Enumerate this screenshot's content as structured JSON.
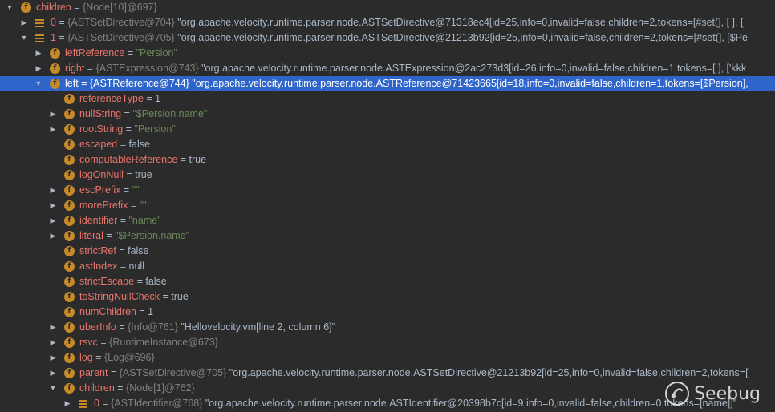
{
  "watermark": {
    "text": "Seebug",
    "icon": "seebug-logo-icon"
  },
  "rows": [
    {
      "depth": 0,
      "arrow": "down",
      "icon": "field",
      "name": "children",
      "type": "{Node[10]@697}",
      "desc": ""
    },
    {
      "depth": 1,
      "arrow": "right",
      "icon": "array",
      "name": "0",
      "type": "{ASTSetDirective@704}",
      "desc": "\"org.apache.velocity.runtime.parser.node.ASTSetDirective@71318ec4[id=25,info=0,invalid=false,children=2,tokens=[#set(], [ ], ["
    },
    {
      "depth": 1,
      "arrow": "down",
      "icon": "array",
      "name": "1",
      "type": "{ASTSetDirective@705}",
      "desc": "\"org.apache.velocity.runtime.parser.node.ASTSetDirective@21213b92[id=25,info=0,invalid=false,children=2,tokens=[#set(], [$Pe"
    },
    {
      "depth": 2,
      "arrow": "right",
      "icon": "field",
      "name": "leftReference",
      "type": "",
      "desc": "",
      "str": "\"Persion\""
    },
    {
      "depth": 2,
      "arrow": "right",
      "icon": "field",
      "name": "right",
      "type": "{ASTExpression@743}",
      "desc": "\"org.apache.velocity.runtime.parser.node.ASTExpression@2ac273d3[id=26,info=0,invalid=false,children=1,tokens=[ ], ['kkk"
    },
    {
      "depth": 2,
      "arrow": "down",
      "icon": "field",
      "name": "left",
      "type": "{ASTReference@744}",
      "desc": "\"org.apache.velocity.runtime.parser.node.ASTReference@71423665[id=18,info=0,invalid=false,children=1,tokens=[$Persion],",
      "selected": true
    },
    {
      "depth": 3,
      "arrow": "",
      "icon": "field",
      "name": "referenceType",
      "value": "1"
    },
    {
      "depth": 3,
      "arrow": "right",
      "icon": "field",
      "name": "nullString",
      "str": "\"$Persion.name\""
    },
    {
      "depth": 3,
      "arrow": "right",
      "icon": "field",
      "name": "rootString",
      "str": "\"Persion\""
    },
    {
      "depth": 3,
      "arrow": "",
      "icon": "field",
      "name": "escaped",
      "value": "false"
    },
    {
      "depth": 3,
      "arrow": "",
      "icon": "field",
      "name": "computableReference",
      "value": "true"
    },
    {
      "depth": 3,
      "arrow": "",
      "icon": "field",
      "name": "logOnNull",
      "value": "true"
    },
    {
      "depth": 3,
      "arrow": "right",
      "icon": "field",
      "name": "escPrefix",
      "str": "\"\""
    },
    {
      "depth": 3,
      "arrow": "right",
      "icon": "field",
      "name": "morePrefix",
      "str": "\"\""
    },
    {
      "depth": 3,
      "arrow": "right",
      "icon": "field",
      "name": "identifier",
      "str": "\"name\""
    },
    {
      "depth": 3,
      "arrow": "right",
      "icon": "field",
      "name": "literal",
      "str": "\"$Persion.name\""
    },
    {
      "depth": 3,
      "arrow": "",
      "icon": "field",
      "name": "strictRef",
      "value": "false"
    },
    {
      "depth": 3,
      "arrow": "",
      "icon": "field",
      "name": "astIndex",
      "value": "null"
    },
    {
      "depth": 3,
      "arrow": "",
      "icon": "field",
      "name": "strictEscape",
      "value": "false"
    },
    {
      "depth": 3,
      "arrow": "",
      "icon": "field",
      "name": "toStringNullCheck",
      "value": "true"
    },
    {
      "depth": 3,
      "arrow": "",
      "icon": "field",
      "name": "numChildren",
      "value": "1"
    },
    {
      "depth": 3,
      "arrow": "right",
      "icon": "field",
      "name": "uberInfo",
      "type": "{Info@761}",
      "desc": "\"Hellovelocity.vm[line 2, column 6]\""
    },
    {
      "depth": 3,
      "arrow": "right",
      "icon": "field",
      "name": "rsvc",
      "type": "{RuntimeInstance@673}",
      "desc": ""
    },
    {
      "depth": 3,
      "arrow": "right",
      "icon": "field",
      "name": "log",
      "type": "{Log@696}",
      "desc": ""
    },
    {
      "depth": 3,
      "arrow": "right",
      "icon": "field",
      "name": "parent",
      "type": "{ASTSetDirective@705}",
      "desc": "\"org.apache.velocity.runtime.parser.node.ASTSetDirective@21213b92[id=25,info=0,invalid=false,children=2,tokens=["
    },
    {
      "depth": 3,
      "arrow": "down",
      "icon": "field",
      "name": "children",
      "type": "{Node[1]@762}",
      "desc": ""
    },
    {
      "depth": 4,
      "arrow": "right",
      "icon": "array",
      "name": "0",
      "type": "{ASTIdentifier@768}",
      "desc": "\"org.apache.velocity.runtime.parser.node.ASTIdentifier@20398b7c[id=9,info=0,invalid=false,children=0,tokens=[name]]\""
    }
  ]
}
